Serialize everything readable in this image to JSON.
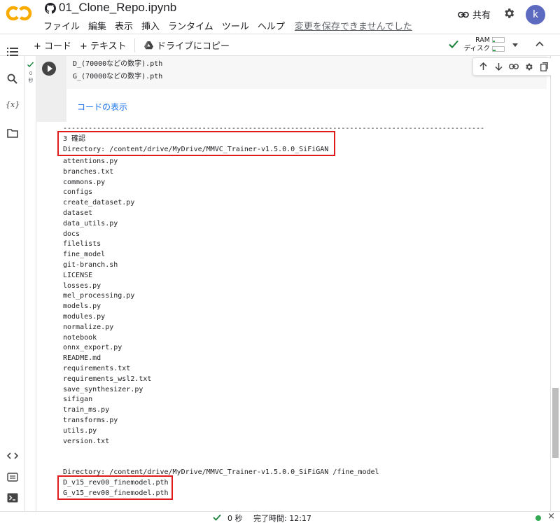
{
  "app": {
    "title": "01_Clone_Repo.ipynb",
    "menu": [
      "ファイル",
      "編集",
      "表示",
      "挿入",
      "ランタイム",
      "ツール",
      "ヘルプ"
    ],
    "unsaved_notice": "変更を保存できませんでした",
    "share_label": "共有",
    "avatar_letter": "k",
    "brand_color": "#f9ab00"
  },
  "toolbar": {
    "add_code": "+ コード",
    "add_text": "+ テキスト",
    "copy_to_drive": "ドライブにコピー",
    "ram_label": "RAM",
    "disk_label": "ディスク",
    "ram_usage": 0.2,
    "disk_usage": 0.25
  },
  "cell": {
    "exec_time_top": "0",
    "exec_time_unit": "秒",
    "code_lines": [
      "D_(70000などの数字).pth",
      "G_(70000などの数字).pth"
    ],
    "show_code_link": "コードの表示"
  },
  "output": {
    "separator": "----------------------------------------------------------------------------------------------------",
    "step_label": "3 確認",
    "directory_line": "Directory: /content/drive/MyDrive/MMVC_Trainer-v1.5.0.0_SiFiGAN",
    "files": [
      "attentions.py",
      "branches.txt",
      "commons.py",
      "configs",
      "create_dataset.py",
      "dataset",
      "data_utils.py",
      "docs",
      "filelists",
      "fine_model",
      "git-branch.sh",
      "LICENSE",
      "losses.py",
      "mel_processing.py",
      "models.py",
      "modules.py",
      "normalize.py",
      "notebook",
      "onnx_export.py",
      "README.md",
      "requirements.txt",
      "requirements_wsl2.txt",
      "save_synthesizer.py",
      "sifigan",
      "train_ms.py",
      "transforms.py",
      "utils.py",
      "version.txt"
    ],
    "fine_model_dir": "Directory: /content/drive/MyDrive/MMVC_Trainer-v1.5.0.0_SiFiGAN /fine_model",
    "fine_model_files": [
      "D_v15_rev00_finemodel.pth",
      "G_v15_rev00_finemodel.pth"
    ],
    "highlight_color": "#e01b1b"
  },
  "status": {
    "time": "0 秒",
    "completed": "完了時間: 12:17",
    "close": "×"
  }
}
